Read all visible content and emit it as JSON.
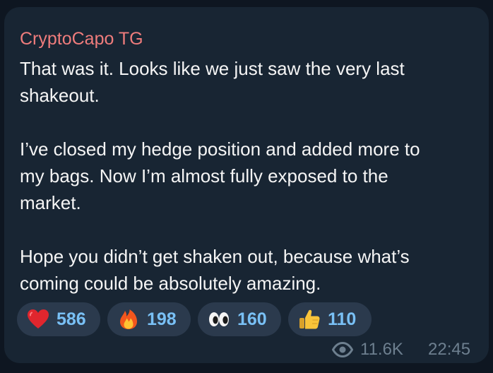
{
  "message": {
    "sender": "CryptoCapo TG",
    "paragraphs": [
      {
        "lines": [
          "That was it. Looks like we just saw the very last",
          "shakeout."
        ]
      },
      {
        "lines": [
          "I’ve closed my hedge position and added more to",
          "my bags. Now I’m almost fully exposed to the",
          "market."
        ]
      },
      {
        "lines": [
          "Hope you didn’t get shaken out, because what’s",
          "coming could be absolutely amazing."
        ]
      }
    ],
    "reactions": [
      {
        "icon": "red-heart-icon",
        "count": "586"
      },
      {
        "icon": "fire-icon",
        "count": "198"
      },
      {
        "icon": "eyes-icon",
        "count": "160"
      },
      {
        "icon": "thumbs-up-icon",
        "count": "110"
      }
    ],
    "views_icon": "eye-icon",
    "views": "11.6K",
    "time": "22:45"
  },
  "colors": {
    "background": "#0e1621",
    "bubble": "#182533",
    "sender": "#ef7c7c",
    "text": "#f5f5f5",
    "reaction_pill": "#2b3a4d",
    "reaction_count": "#79c0f5",
    "meta": "#6d7f8f"
  }
}
